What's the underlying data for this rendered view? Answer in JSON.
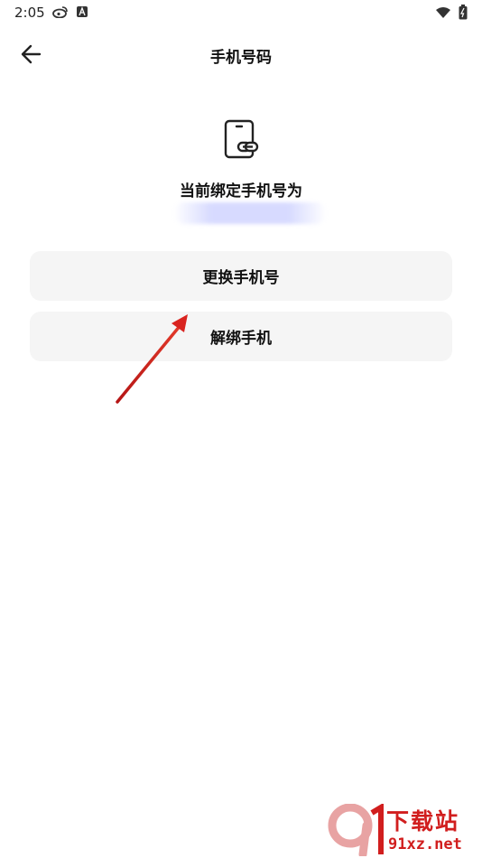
{
  "status_bar": {
    "time": "2:05",
    "left_icons": [
      "weibo-icon",
      "a-notification-icon"
    ],
    "right_icons": [
      "wifi-icon",
      "battery-icon"
    ]
  },
  "header": {
    "title": "手机号码",
    "back_icon": "arrow-left-icon"
  },
  "bind_info": {
    "icon": "phone-link-icon",
    "label": "当前绑定手机号为",
    "number": ""
  },
  "actions": {
    "change_label": "更换手机号",
    "unbind_label": "解绑手机"
  },
  "annotation": {
    "arrow_color": "#d9231f"
  },
  "watermark": {
    "logo_text": "9",
    "text_top": "下载站",
    "text_bottom": "91xz.net",
    "color": "#d11e1e"
  },
  "colors": {
    "background": "#ffffff",
    "button_bg": "#f5f5f5",
    "text": "#111111"
  }
}
